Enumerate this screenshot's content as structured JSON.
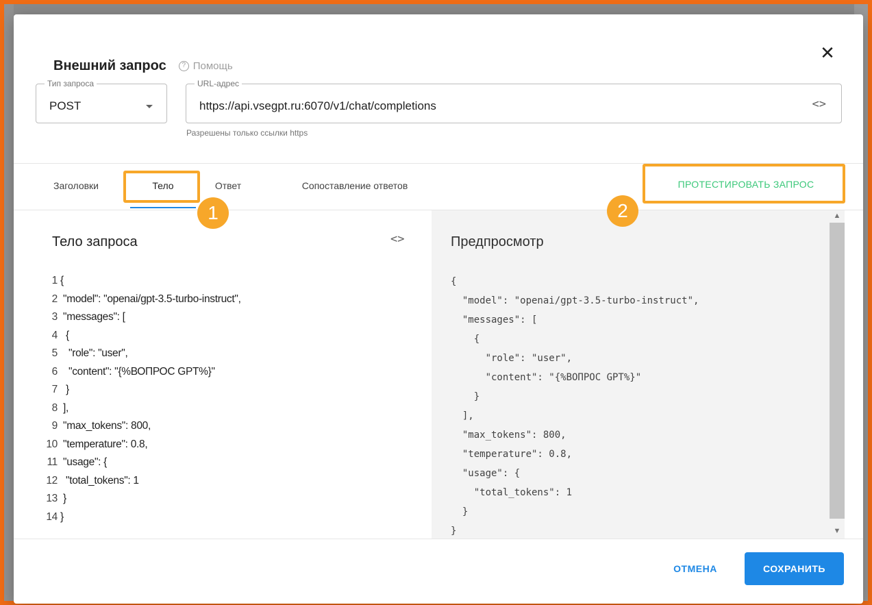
{
  "dialog": {
    "title": "Внешний запрос",
    "help_label": "Помощь",
    "help_icon": "?",
    "close_label": "✕"
  },
  "request_type": {
    "label": "Тип запроса",
    "value": "POST"
  },
  "url": {
    "label": "URL-адрес",
    "value": "https://api.vsegpt.ru:6070/v1/chat/completions",
    "hint": "Разрешены только ссылки https",
    "code_icon": "<>"
  },
  "tabs": [
    {
      "label": "Заголовки"
    },
    {
      "label": "Тело"
    },
    {
      "label": "Ответ"
    },
    {
      "label": "Сопоставление ответов"
    }
  ],
  "active_tab": "Тело",
  "test_button_label": "ПРОТЕСТИРОВАТЬ ЗАПРОС",
  "annotations": [
    {
      "number": "1"
    },
    {
      "number": "2"
    }
  ],
  "annotation_color": "#f7a72a",
  "editor": {
    "title": "Тело запроса",
    "code_icon": "<>",
    "lines": [
      {
        "num": "1",
        "text": "{"
      },
      {
        "num": "2",
        "text": " \"model\": \"openai/gpt-3.5-turbo-instruct\","
      },
      {
        "num": "3",
        "text": " \"messages\": ["
      },
      {
        "num": "4",
        "text": "  {"
      },
      {
        "num": "5",
        "text": "   \"role\": \"user\","
      },
      {
        "num": "6",
        "text": "   \"content\": \"{%ВОПРОС GPT%}\""
      },
      {
        "num": "7",
        "text": "  }"
      },
      {
        "num": "8",
        "text": " ],"
      },
      {
        "num": "9",
        "text": " \"max_tokens\": 800,"
      },
      {
        "num": "10",
        "text": " \"temperature\": 0.8,"
      },
      {
        "num": "11",
        "text": " \"usage\": {"
      },
      {
        "num": "12",
        "text": "  \"total_tokens\": 1"
      },
      {
        "num": "13",
        "text": " }"
      },
      {
        "num": "14",
        "text": "}"
      }
    ]
  },
  "preview": {
    "title": "Предпросмотр",
    "lines": [
      "{",
      "  \"model\": \"openai/gpt-3.5-turbo-instruct\",",
      "  \"messages\": [",
      "    {",
      "      \"role\": \"user\",",
      "      \"content\": \"{%ВОПРОС GPT%}\"",
      "    }",
      "  ],",
      "  \"max_tokens\": 800,",
      "  \"temperature\": 0.8,",
      "  \"usage\": {",
      "    \"total_tokens\": 1",
      "  }",
      "}"
    ]
  },
  "footer": {
    "cancel_label": "ОТМЕНА",
    "save_label": "СОХРАНИТЬ"
  },
  "colors": {
    "accent": "#1e88e5",
    "test_button": "#3cc87a",
    "frame": "#f06c15"
  }
}
